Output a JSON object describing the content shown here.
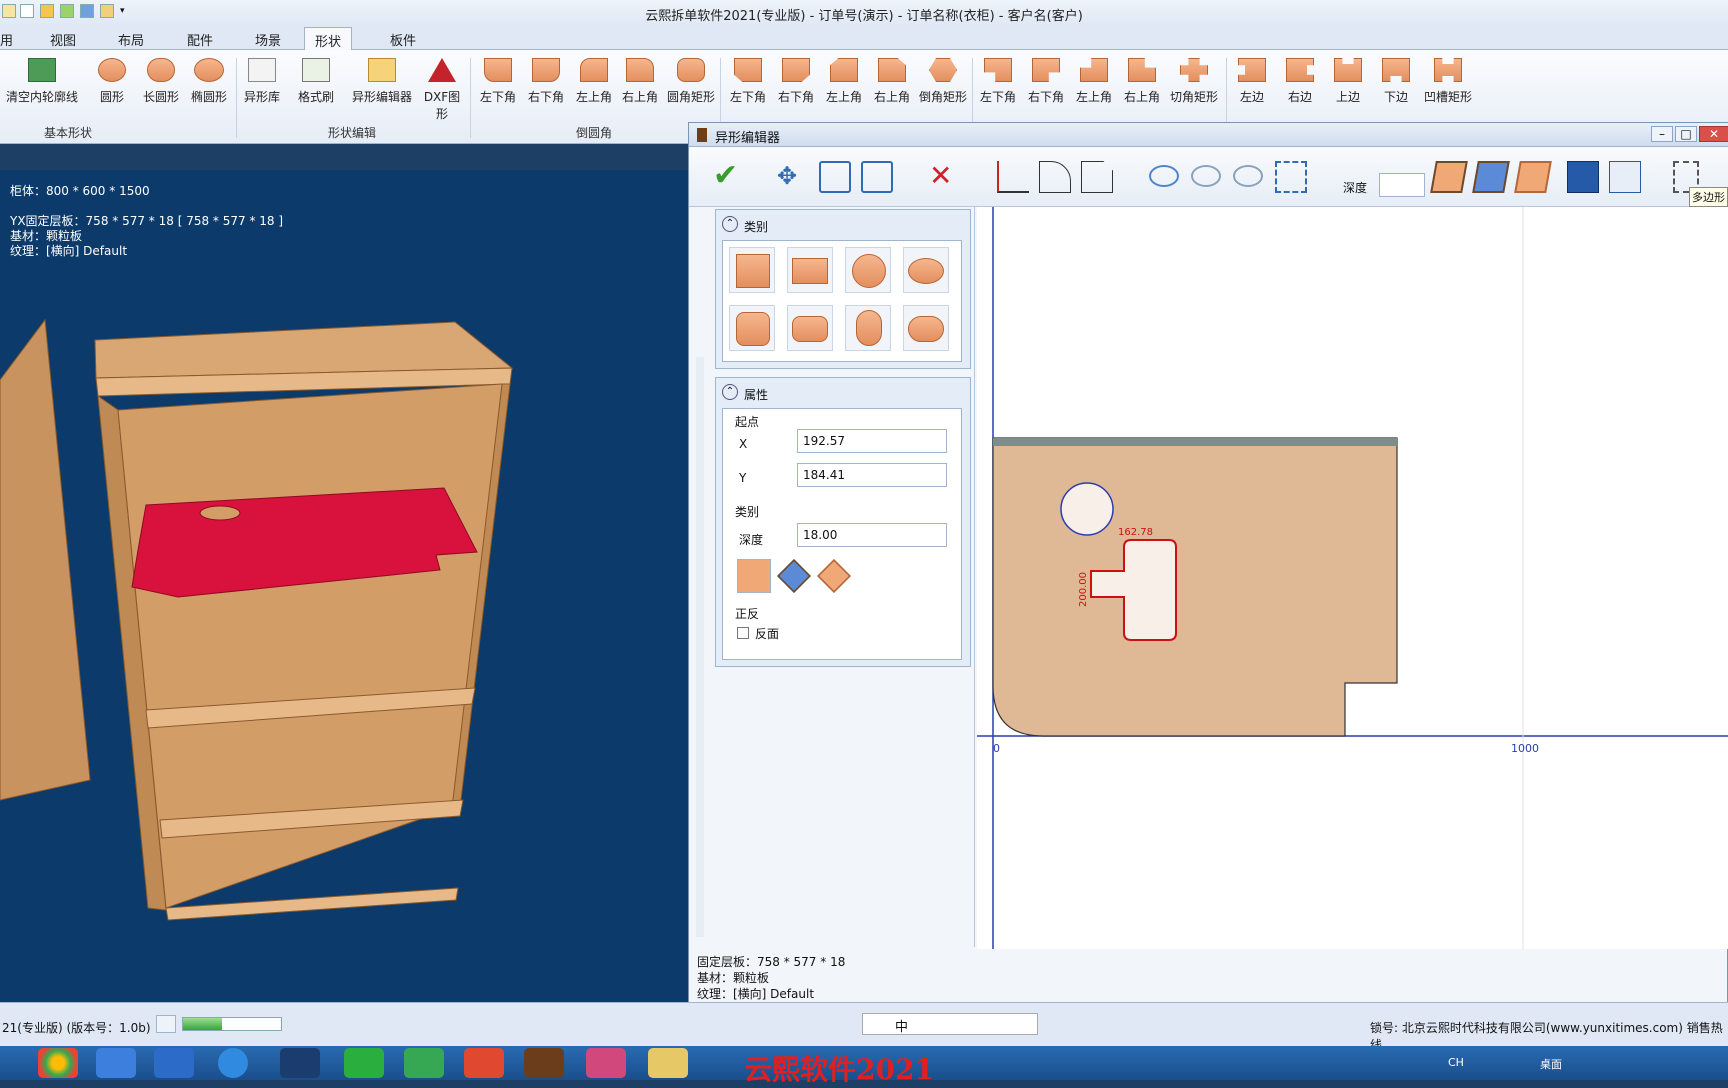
{
  "window": {
    "title": "云熙拆单软件2021(专业版) - 订单号(演示) - 订单名称(衣柜) - 客户名(客户)"
  },
  "ribbon": {
    "tabs": [
      "用",
      "视图",
      "布局",
      "配件",
      "场景",
      "形状",
      "板件"
    ],
    "active_tab": "形状",
    "groups": {
      "basic": "基本形状",
      "edit": "形状编辑",
      "round": "倒圆角"
    },
    "buttons": [
      "清空内轮廓线",
      "圆形",
      "长圆形",
      "椭圆形",
      "异形库",
      "格式刷",
      "异形编辑器",
      "DXF图形",
      "左下角",
      "右下角",
      "左上角",
      "右上角",
      "圆角矩形",
      "左下角",
      "右下角",
      "左上角",
      "右上角",
      "倒角矩形",
      "左下角",
      "右下角",
      "左上角",
      "右上角",
      "切角矩形",
      "左边",
      "右边",
      "上边",
      "下边",
      "凹槽矩形"
    ]
  },
  "view3d": {
    "cabinet": "柜体：800 * 600 * 1500",
    "panel": "YX固定层板：758 * 577 * 18 [ 758 * 577 * 18 ]",
    "material": "基材：颗粒板",
    "grain": "纹理：[横向] Default"
  },
  "editor": {
    "title": "异形编辑器",
    "depth_label": "深度",
    "tooltip": "多边形",
    "category_title": "类别",
    "props_title": "属性",
    "start_label": "起点",
    "x_label": "X",
    "x_value": "192.57",
    "y_label": "Y",
    "y_value": "184.41",
    "cat_label": "类别",
    "depth_field_label": "深度",
    "depth_value": "18.00",
    "side_label": "正反",
    "reverse_label": "反面",
    "dim_width": "162.78",
    "dim_height": "200.00",
    "axis_0": "0",
    "axis_1000": "1000",
    "info_panel": "固定层板：758 * 577 * 18",
    "info_material": "基材：颗粒板",
    "info_grain": "纹理：[横向] Default"
  },
  "status": {
    "version": "21(专业版) (版本号：1.0b)",
    "lock": "锁号: 北京云熙时代科技有限公司(www.yunxitimes.com)  销售热线"
  },
  "taskbar": {
    "brand": "云熙软件2021",
    "ime": "中",
    "lang": "CH",
    "desktop": "桌面"
  },
  "colors": {
    "accent": "#1a4e8c",
    "panel_red": "#d8123c",
    "board": "#dfb895",
    "cut": "#cc1111"
  }
}
